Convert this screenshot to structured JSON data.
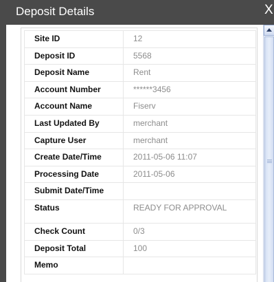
{
  "dialog": {
    "title": "Deposit Details",
    "close_glyph": "X"
  },
  "details": [
    {
      "label": "Site ID",
      "value": "12"
    },
    {
      "label": "Deposit ID",
      "value": "5568"
    },
    {
      "label": "Deposit Name",
      "value": "Rent"
    },
    {
      "label": "Account Number",
      "value": "******3456"
    },
    {
      "label": "Account Name",
      "value": "Fiserv"
    },
    {
      "label": "Last Updated By",
      "value": "merchant"
    },
    {
      "label": "Capture User",
      "value": "merchant"
    },
    {
      "label": "Create Date/Time",
      "value": "2011-05-06 11:07"
    },
    {
      "label": "Processing Date",
      "value": "2011-05-06"
    },
    {
      "label": "Submit Date/Time",
      "value": ""
    },
    {
      "label": "Status",
      "value": "READY FOR APPROVAL"
    },
    {
      "label": "Check Count",
      "value": "0/3"
    },
    {
      "label": "Deposit Total",
      "value": "100"
    },
    {
      "label": "Memo",
      "value": ""
    }
  ]
}
